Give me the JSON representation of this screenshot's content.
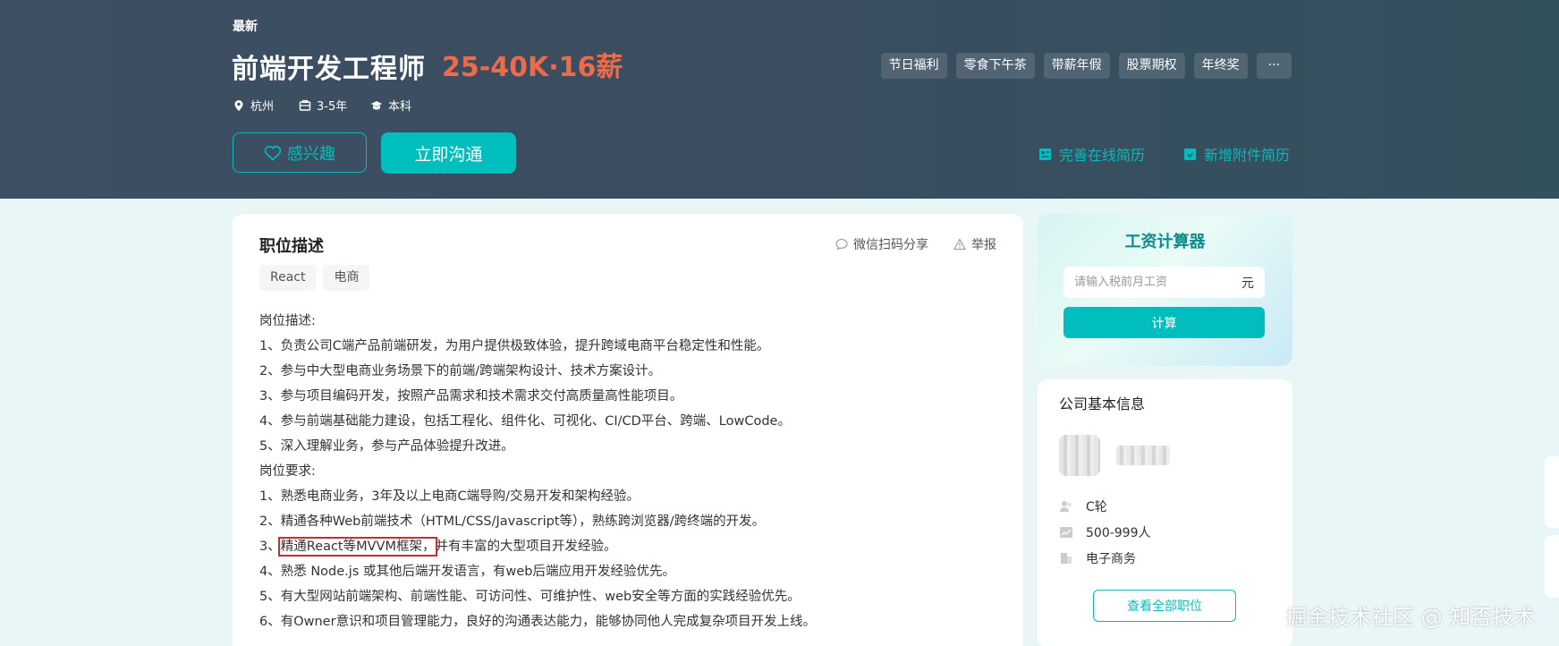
{
  "header": {
    "badge": "最新",
    "title": "前端开发工程师",
    "salary": "25-40K·16薪",
    "meta": {
      "city": "杭州",
      "experience": "3-5年",
      "education": "本科"
    },
    "benefits": [
      "节日福利",
      "零食下午茶",
      "带薪年假",
      "股票期权",
      "年终奖",
      "···"
    ],
    "interest_label": "感兴趣",
    "chat_label": "立即沟通",
    "links": {
      "improve_resume": "完善在线简历",
      "add_attachment": "新增附件简历"
    }
  },
  "job": {
    "section_title": "职位描述",
    "share_label": "微信扫码分享",
    "report_label": "举报",
    "skill_tags": [
      "React",
      "电商"
    ],
    "lines": [
      "岗位描述:",
      "1、负责公司C端产品前端研发，为用户提供极致体验，提升跨域电商平台稳定性和性能。",
      "2、参与中大型电商业务场景下的前端/跨端架构设计、技术方案设计。",
      "3、参与项目编码开发，按照产品需求和技术需求交付高质量高性能项目。",
      "4、参与前端基础能力建设，包括工程化、组件化、可视化、CI/CD平台、跨端、LowCode。",
      "5、深入理解业务，参与产品体验提升改进。",
      "岗位要求:",
      "1、熟悉电商业务，3年及以上电商C端导购/交易开发和架构经验。",
      "2、精通各种Web前端技术（HTML/CSS/Javascript等），熟练跨浏览器/跨终端的开发。"
    ],
    "highlight_line": {
      "prefix": "3、",
      "highlighted": "精通React等MVVM框架，",
      "suffix": "并有丰富的大型项目开发经验。"
    },
    "lines_after": [
      "4、熟悉 Node.js 或其他后端开发语言，有web后端应用开发经验优先。",
      "5、有大型网站前端架构、前端性能、可访问性、可维护性、web安全等方面的实践经验优先。",
      "6、有Owner意识和项目管理能力，良好的沟通表达能力，能够协同他人完成复杂项目开发上线。"
    ]
  },
  "calculator": {
    "title": "工资计算器",
    "placeholder": "请输入税前月工资",
    "unit": "元",
    "button": "计算"
  },
  "company": {
    "title": "公司基本信息",
    "stage": "C轮",
    "size": "500-999人",
    "industry": "电子商务",
    "all_jobs": "查看全部职位"
  },
  "watermark": "掘金技术社区 @ 知否技术",
  "colors": {
    "accent": "#00bebd",
    "salary": "#f06a4a",
    "banner": "#3d4f62",
    "highlight_box": "#cc2b2b"
  }
}
